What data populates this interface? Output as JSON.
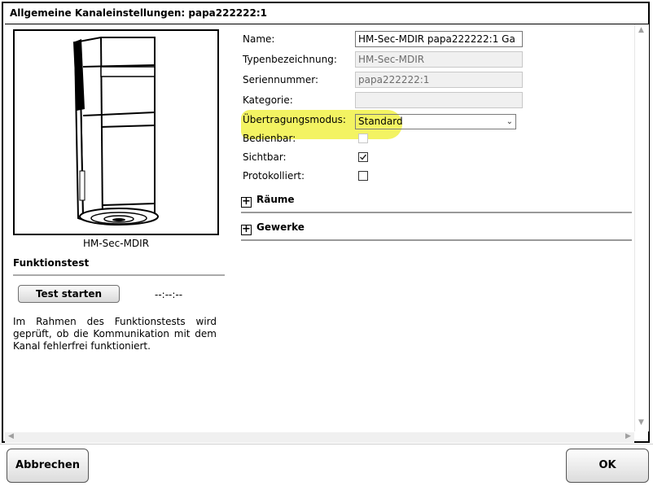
{
  "dialog": {
    "title": "Allgemeine Kanaleinstellungen: papa222222:1"
  },
  "device": {
    "caption": "HM-Sec-MDIR"
  },
  "funktionstest": {
    "heading": "Funktionstest",
    "button_label": "Test starten",
    "status": "--:--:--",
    "description": "Im Rahmen des Funktionstests wird geprüft, ob die Kommunikation mit dem Kanal fehlerfrei funktioniert."
  },
  "form": {
    "name_label": "Name:",
    "name_value": "HM-Sec-MDIR papa222222:1 Ga",
    "type_label": "Typenbezeichnung:",
    "type_value": "HM-Sec-MDIR",
    "serial_label": "Seriennummer:",
    "serial_value": "papa222222:1",
    "category_label": "Kategorie:",
    "category_value": "",
    "mode_label": "Übertragungsmodus:",
    "mode_value": "Standard",
    "operable_label": "Bedienbar:",
    "visible_label": "Sichtbar:",
    "logged_label": "Protokolliert:",
    "operable_checked": false,
    "visible_checked": true,
    "logged_checked": false,
    "highlight_color": "#f2f25a"
  },
  "groups": {
    "rooms": "Räume",
    "functions": "Gewerke"
  },
  "footer": {
    "cancel_label": "Abbrechen",
    "ok_label": "OK"
  }
}
